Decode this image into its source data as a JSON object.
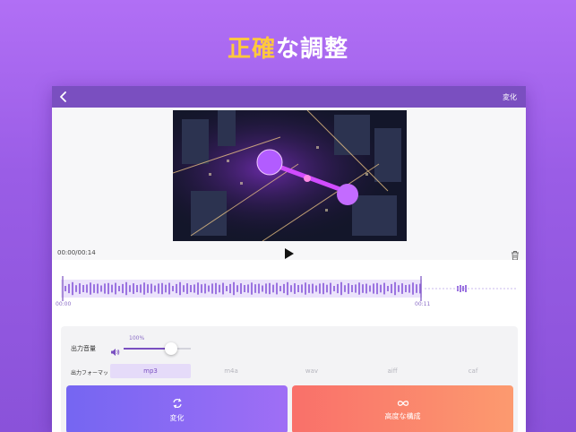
{
  "headline": {
    "part1": "正確",
    "part2": "な調整"
  },
  "topbar": {
    "action_label": "変化"
  },
  "player": {
    "time": "00:00/00:14"
  },
  "waveform": {
    "start_label": "00:00",
    "end_label": "00:11"
  },
  "volume": {
    "label": "出力音量",
    "percent_label": "100%",
    "level": 0.7
  },
  "format": {
    "label": "出力フォーマット",
    "options": [
      "mp3",
      "m4a",
      "wav",
      "aiff",
      "caf"
    ],
    "selected": "mp3"
  },
  "buttons": {
    "convert_label": "変化",
    "advanced_label": "高度な構成"
  },
  "colors": {
    "accent": "#7a4fc0",
    "highlight": "#ffc83d",
    "convert_button": "#8a6af4",
    "advanced_button": "#fb8a6d"
  },
  "icons": [
    "back-chevron-icon",
    "play-icon",
    "trash-icon",
    "speaker-icon",
    "convert-icon",
    "infinity-icon"
  ]
}
